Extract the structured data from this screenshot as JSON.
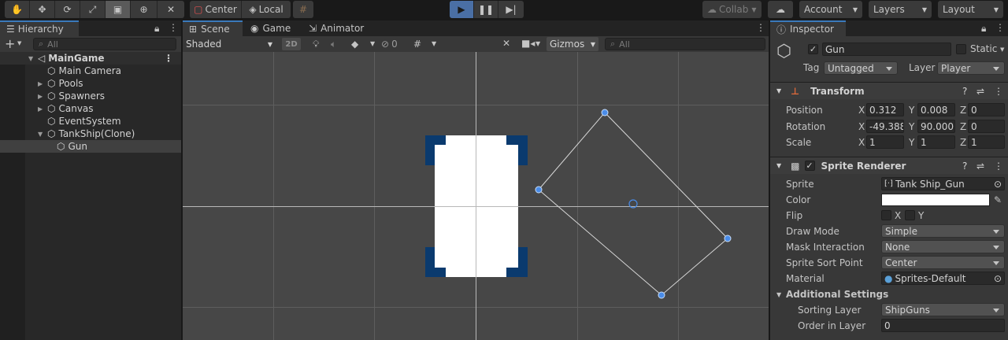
{
  "toolbar": {
    "tools": [
      "hand-tool",
      "move-tool",
      "rotate-tool",
      "scale-tool",
      "rect-tool",
      "transform-tool",
      "custom-tool"
    ],
    "pivot_mode": "Center",
    "pivot_rotation": "Local",
    "collab": "Collab",
    "account": "Account",
    "layers": "Layers",
    "layout": "Layout"
  },
  "hierarchy": {
    "tab": "Hierarchy",
    "search_placeholder": "All",
    "scene": "MainGame",
    "items": [
      {
        "label": "Main Camera",
        "depth": 1,
        "expand": false
      },
      {
        "label": "Pools",
        "depth": 1,
        "expand": true
      },
      {
        "label": "Spawners",
        "depth": 1,
        "expand": true
      },
      {
        "label": "Canvas",
        "depth": 1,
        "expand": true
      },
      {
        "label": "EventSystem",
        "depth": 1,
        "expand": false
      },
      {
        "label": "TankShip(Clone)",
        "depth": 1,
        "expand": true
      },
      {
        "label": "Gun",
        "depth": 2,
        "expand": false
      }
    ]
  },
  "scene": {
    "tabs": [
      "Scene",
      "Game",
      "Animator"
    ],
    "shading": "Shaded",
    "mode2d": "2D",
    "hidden_count": "0",
    "gizmos": "Gizmos",
    "search_placeholder": "All"
  },
  "inspector": {
    "tab": "Inspector",
    "name": "Gun",
    "static_label": "Static",
    "tag_label": "Tag",
    "tag": "Untagged",
    "layer_label": "Layer",
    "layer": "Player",
    "transform": {
      "title": "Transform",
      "position_label": "Position",
      "rotation_label": "Rotation",
      "scale_label": "Scale",
      "position": [
        "0.312",
        "0.008",
        "0"
      ],
      "rotation": [
        "-49.388",
        "90.000",
        "0"
      ],
      "scale": [
        "1",
        "1",
        "1"
      ]
    },
    "sprite_renderer": {
      "title": "Sprite Renderer",
      "sprite_label": "Sprite",
      "sprite": "Tank Ship_Gun",
      "color_label": "Color",
      "flip_label": "Flip",
      "flip_x": "X",
      "flip_y": "Y",
      "draw_mode_label": "Draw Mode",
      "draw_mode": "Simple",
      "mask_label": "Mask Interaction",
      "mask": "None",
      "sort_point_label": "Sprite Sort Point",
      "sort_point": "Center",
      "material_label": "Material",
      "material": "Sprites-Default",
      "additional": "Additional Settings",
      "sorting_layer_label": "Sorting Layer",
      "sorting_layer": "ShipGuns",
      "order_label": "Order in Layer",
      "order": "0"
    }
  },
  "colors": {
    "accent": "#3a79bb",
    "sprite_dark": "#0a3a6e",
    "background": "#474747"
  }
}
